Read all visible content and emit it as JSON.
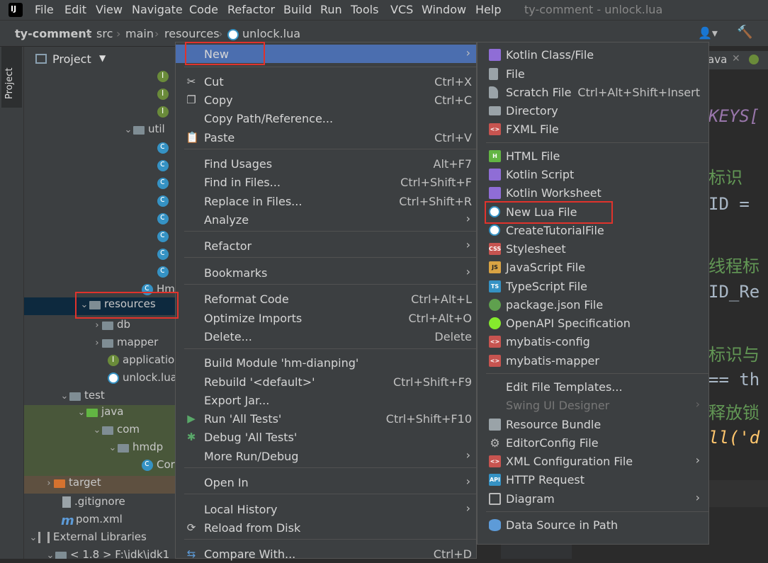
{
  "menubar": {
    "items": [
      "File",
      "Edit",
      "View",
      "Navigate",
      "Code",
      "Refactor",
      "Build",
      "Run",
      "Tools",
      "VCS",
      "Window",
      "Help"
    ],
    "window_title": "ty-comment - unlock.lua"
  },
  "breadcrumb": {
    "project": "ty-comment",
    "parts": [
      "src",
      "main",
      "resources"
    ],
    "file": "unlock.lua"
  },
  "stripe": {
    "tab_label": "Project"
  },
  "project_panel": {
    "title": "Project",
    "rows": {
      "util": "util",
      "hm": "Hm",
      "resources": "resources",
      "db": "db",
      "mapper": "mapper",
      "application": "applicatio",
      "unlock": "unlock.lua",
      "test": "test",
      "java": "java",
      "com": "com",
      "hmdp": "hmdp",
      "cor": "Cor",
      "target": "target",
      "gitignore": ".gitignore",
      "pom": "pom.xml",
      "ext": "External Libraries",
      "jdk": "< 1.8 >  F:\\jdk\\jdk1"
    }
  },
  "editor": {
    "tab_partial": "ava",
    "lines": {
      "keys": "KEYS[",
      "c1": "标识",
      "id": "ID = ",
      "c2": "线程标",
      "idr": "ID_Re",
      "c3": "标识与",
      "eq": "== th",
      "c4": "释放锁",
      "call": "ll('d"
    }
  },
  "context_menu": {
    "new": "New",
    "cut": "Cut",
    "cut_sc": "Ctrl+X",
    "copy": "Copy",
    "copy_sc": "Ctrl+C",
    "copy_path": "Copy Path/Reference...",
    "paste": "Paste",
    "paste_sc": "Ctrl+V",
    "find_usages": "Find Usages",
    "find_usages_sc": "Alt+F7",
    "find_in_files": "Find in Files...",
    "find_in_files_sc": "Ctrl+Shift+F",
    "replace_in_files": "Replace in Files...",
    "replace_in_files_sc": "Ctrl+Shift+R",
    "analyze": "Analyze",
    "refactor": "Refactor",
    "bookmarks": "Bookmarks",
    "reformat": "Reformat Code",
    "reformat_sc": "Ctrl+Alt+L",
    "optimize": "Optimize Imports",
    "optimize_sc": "Ctrl+Alt+O",
    "delete": "Delete...",
    "delete_sc": "Delete",
    "build_module": "Build Module 'hm-dianping'",
    "rebuild": "Rebuild '<default>'",
    "rebuild_sc": "Ctrl+Shift+F9",
    "export_jar": "Export Jar...",
    "run_tests": "Run 'All Tests'",
    "run_tests_sc": "Ctrl+Shift+F10",
    "debug_tests": "Debug 'All Tests'",
    "more_run": "More Run/Debug",
    "open_in": "Open In",
    "local_history": "Local History",
    "reload": "Reload from Disk",
    "compare": "Compare With...",
    "compare_sc": "Ctrl+D"
  },
  "new_menu": {
    "kotlin_class": "Kotlin Class/File",
    "file": "File",
    "scratch": "Scratch File",
    "scratch_sc": "Ctrl+Alt+Shift+Insert",
    "directory": "Directory",
    "fxml": "FXML File",
    "html": "HTML File",
    "kotlin_script": "Kotlin Script",
    "kotlin_worksheet": "Kotlin Worksheet",
    "lua": "New Lua File",
    "tutorial": "CreateTutorialFile",
    "stylesheet": "Stylesheet",
    "javascript": "JavaScript File",
    "typescript": "TypeScript File",
    "package_json": "package.json File",
    "openapi": "OpenAPI Specification",
    "mybatis_config": "mybatis-config",
    "mybatis_mapper": "mybatis-mapper",
    "edit_templates": "Edit File Templates...",
    "swing": "Swing UI Designer",
    "resource_bundle": "Resource Bundle",
    "editorconfig": "EditorConfig File",
    "xml_config": "XML Configuration File",
    "http": "HTTP Request",
    "diagram": "Diagram",
    "datasource": "Data Source in Path"
  },
  "icon_text": {
    "html": "H",
    "css": "CSS",
    "js": "JS",
    "ts": "TS",
    "api": "API"
  },
  "colors": {
    "highlight": "#4b6eaf",
    "annotation_red": "#e0332c",
    "background": "#3c3f41"
  }
}
